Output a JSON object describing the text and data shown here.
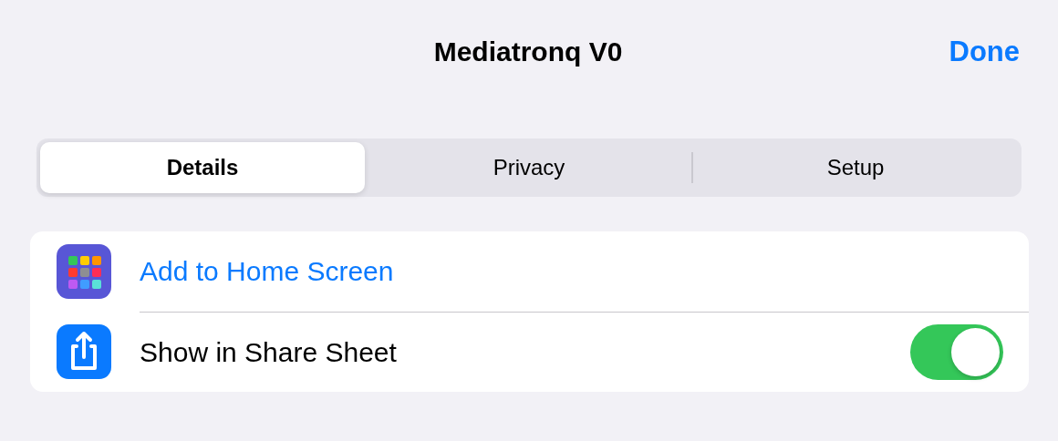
{
  "header": {
    "title": "Mediatronq V0",
    "done": "Done"
  },
  "tabs": [
    {
      "label": "Details",
      "selected": true
    },
    {
      "label": "Privacy",
      "selected": false
    },
    {
      "label": "Setup",
      "selected": false
    }
  ],
  "rows": [
    {
      "kind": "action",
      "label": "Add to Home Screen"
    },
    {
      "kind": "toggle",
      "label": "Show in Share Sheet",
      "on": true
    }
  ]
}
